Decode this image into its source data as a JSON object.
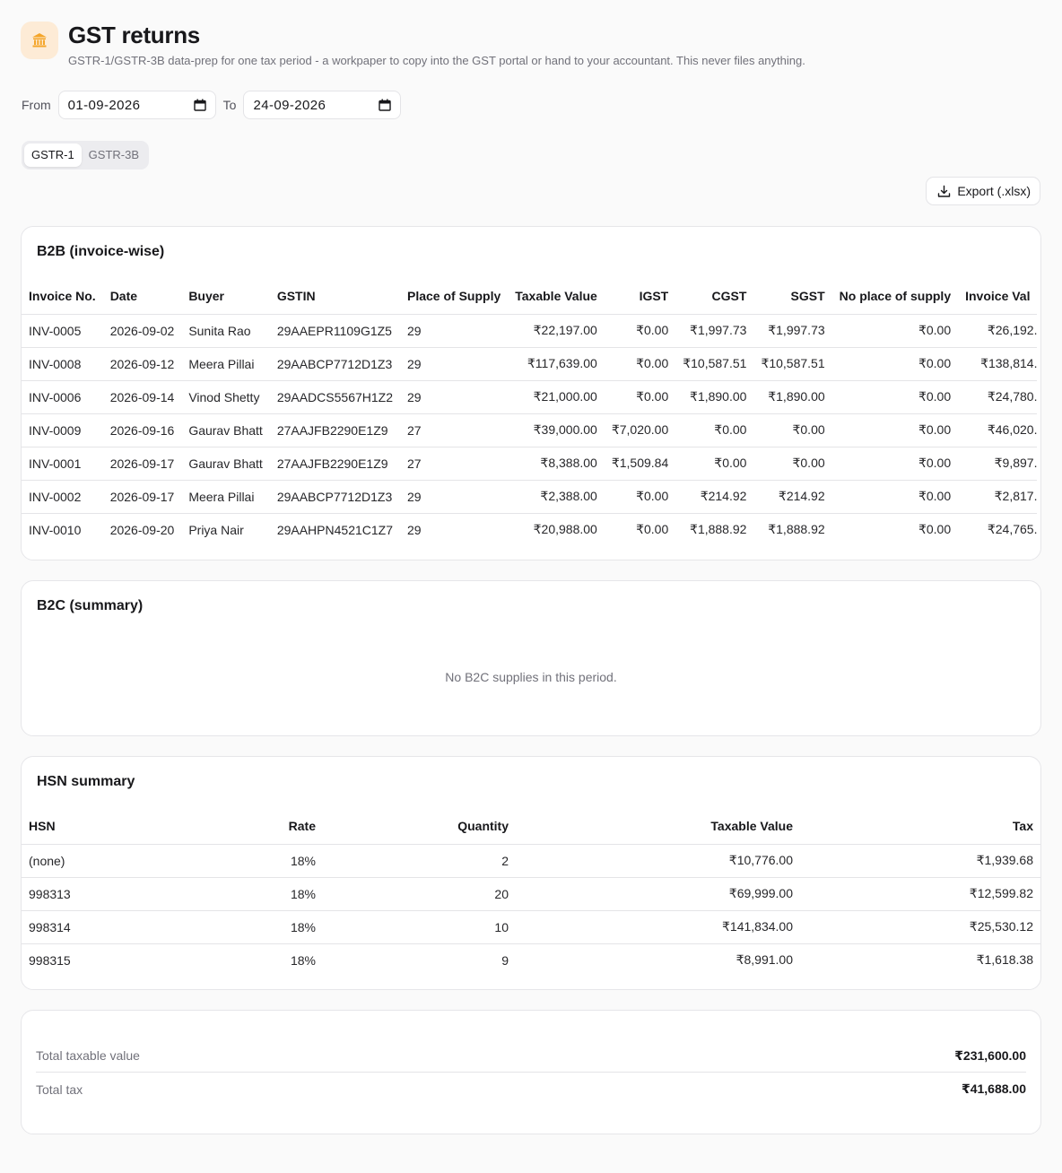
{
  "header": {
    "title": "GST returns",
    "subtitle": "GSTR-1/GSTR-3B data-prep for one tax period - a workpaper to copy into the GST portal or hand to your accountant. This never files anything."
  },
  "filters": {
    "from_label": "From",
    "from_value": "01-09-2026",
    "to_label": "To",
    "to_value": "24-09-2026"
  },
  "tabs": [
    {
      "label": "GSTR-1",
      "active": true
    },
    {
      "label": "GSTR-3B",
      "active": false
    }
  ],
  "export_label": "Export (.xlsx)",
  "b2b": {
    "title": "B2B (invoice-wise)",
    "columns": [
      "Invoice No.",
      "Date",
      "Buyer",
      "GSTIN",
      "Place of Supply",
      "Taxable Value",
      "IGST",
      "CGST",
      "SGST",
      "No place of supply",
      "Invoice Val"
    ],
    "rows": [
      [
        "INV-0005",
        "2026-09-02",
        "Sunita Rao",
        "29AAEPR1109G1Z5",
        "29",
        "₹22,197.00",
        "₹0.00",
        "₹1,997.73",
        "₹1,997.73",
        "₹0.00",
        "₹26,192."
      ],
      [
        "INV-0008",
        "2026-09-12",
        "Meera Pillai",
        "29AABCP7712D1Z3",
        "29",
        "₹117,639.00",
        "₹0.00",
        "₹10,587.51",
        "₹10,587.51",
        "₹0.00",
        "₹138,814."
      ],
      [
        "INV-0006",
        "2026-09-14",
        "Vinod Shetty",
        "29AADCS5567H1Z2",
        "29",
        "₹21,000.00",
        "₹0.00",
        "₹1,890.00",
        "₹1,890.00",
        "₹0.00",
        "₹24,780."
      ],
      [
        "INV-0009",
        "2026-09-16",
        "Gaurav Bhatt",
        "27AAJFB2290E1Z9",
        "27",
        "₹39,000.00",
        "₹7,020.00",
        "₹0.00",
        "₹0.00",
        "₹0.00",
        "₹46,020."
      ],
      [
        "INV-0001",
        "2026-09-17",
        "Gaurav Bhatt",
        "27AAJFB2290E1Z9",
        "27",
        "₹8,388.00",
        "₹1,509.84",
        "₹0.00",
        "₹0.00",
        "₹0.00",
        "₹9,897."
      ],
      [
        "INV-0002",
        "2026-09-17",
        "Meera Pillai",
        "29AABCP7712D1Z3",
        "29",
        "₹2,388.00",
        "₹0.00",
        "₹214.92",
        "₹214.92",
        "₹0.00",
        "₹2,817."
      ],
      [
        "INV-0010",
        "2026-09-20",
        "Priya Nair",
        "29AAHPN4521C1Z7",
        "29",
        "₹20,988.00",
        "₹0.00",
        "₹1,888.92",
        "₹1,888.92",
        "₹0.00",
        "₹24,765."
      ]
    ]
  },
  "b2c": {
    "title": "B2C (summary)",
    "empty_text": "No B2C supplies in this period."
  },
  "hsn": {
    "title": "HSN summary",
    "columns": [
      "HSN",
      "Rate",
      "Quantity",
      "Taxable Value",
      "Tax"
    ],
    "rows": [
      [
        "(none)",
        "18%",
        "2",
        "₹10,776.00",
        "₹1,939.68"
      ],
      [
        "998313",
        "18%",
        "20",
        "₹69,999.00",
        "₹12,599.82"
      ],
      [
        "998314",
        "18%",
        "10",
        "₹141,834.00",
        "₹25,530.12"
      ],
      [
        "998315",
        "18%",
        "9",
        "₹8,991.00",
        "₹1,618.38"
      ]
    ]
  },
  "totals": {
    "taxable_label": "Total taxable value",
    "taxable_value": "₹231,600.00",
    "tax_label": "Total tax",
    "tax_value": "₹41,688.00"
  },
  "colors": {
    "accent": "#f59e0b",
    "logo_bg": "#fdebd6"
  }
}
